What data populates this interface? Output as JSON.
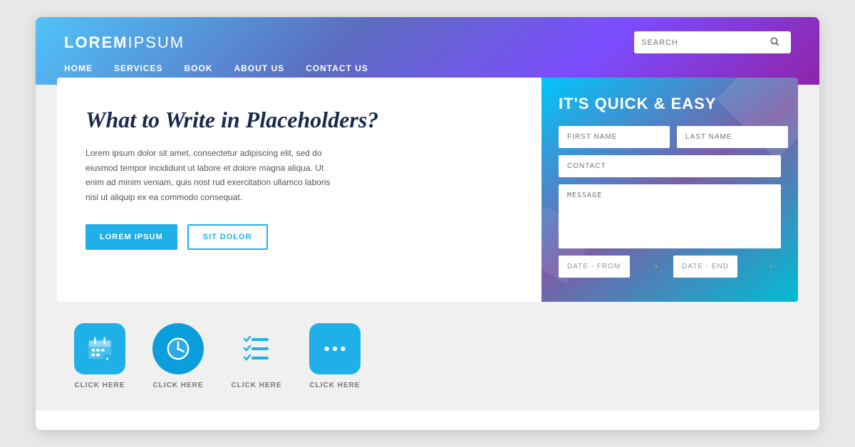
{
  "browser": {
    "frame_bg": "#e8e8e8"
  },
  "header": {
    "logo_bold": "LOREM",
    "logo_light": "IPSUM",
    "search_placeholder": "SEARCH",
    "nav_items": [
      "HOME",
      "SERVICES",
      "BOOK",
      "ABOUT US",
      "CONTACT US"
    ]
  },
  "hero": {
    "title": "What to Write in Placeholders?",
    "body": "Lorem ipsum dolor sit amet, consectetur adipiscing elit, sed do eiusmod tempor incididunt ut labore et dolore magna aliqua. Ut enim ad minim veniam, quis nost rud exercitation ullamco laboris nisi ut aliquip ex ea commodo consequat.",
    "btn_primary": "LOREM IPSUM",
    "btn_secondary": "SIT DOLOR"
  },
  "form": {
    "title": "IT'S QUICK & EASY",
    "first_name_placeholder": "FIRST NAME",
    "last_name_placeholder": "LAST NAME",
    "contact_placeholder": "CONTACT",
    "message_placeholder": "MESSAGE",
    "date_from_placeholder": "DATE - FROM",
    "date_end_placeholder": "DATE - END"
  },
  "icons": [
    {
      "id": "calendar-icon",
      "label": "CLICK HERE",
      "type": "square",
      "shape": "calendar"
    },
    {
      "id": "clock-icon",
      "label": "CLICK HERE",
      "type": "circle",
      "shape": "clock"
    },
    {
      "id": "list-icon",
      "label": "CLICK HERE",
      "type": "plain",
      "shape": "list"
    },
    {
      "id": "dots-icon",
      "label": "CLICK HERE",
      "type": "square",
      "shape": "dots"
    }
  ]
}
